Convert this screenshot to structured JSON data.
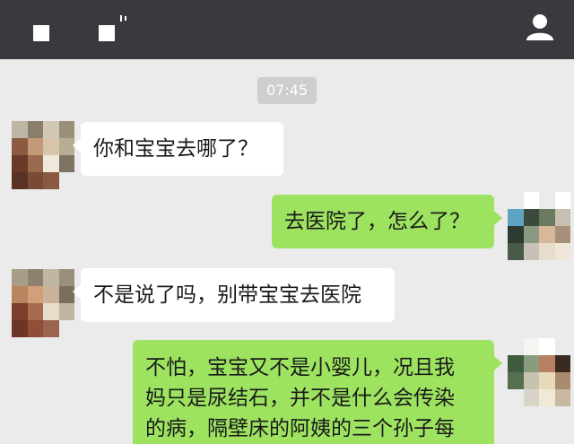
{
  "header": {
    "icons": [
      "app-icon",
      "app-icon",
      "profile-icon"
    ]
  },
  "timestamp": "07:45",
  "messages": [
    {
      "side": "in",
      "text": "你和宝宝去哪了？"
    },
    {
      "side": "out",
      "text": "去医院了，怎么了？"
    },
    {
      "side": "in",
      "text": "不是说了吗，别带宝宝去医院"
    },
    {
      "side": "out",
      "lines": [
        "不怕，宝宝又不是小婴儿，况且我",
        "妈只是尿结石，并不是什么会传染",
        "的病，隔壁床的阿姨的三个孙子每"
      ]
    }
  ],
  "colors": {
    "header_bg": "#393a3f",
    "chat_bg": "#ebebeb",
    "incoming_bubble": "#ffffff",
    "outgoing_bubble": "#9de360",
    "timestamp_bg": "#cecece"
  }
}
